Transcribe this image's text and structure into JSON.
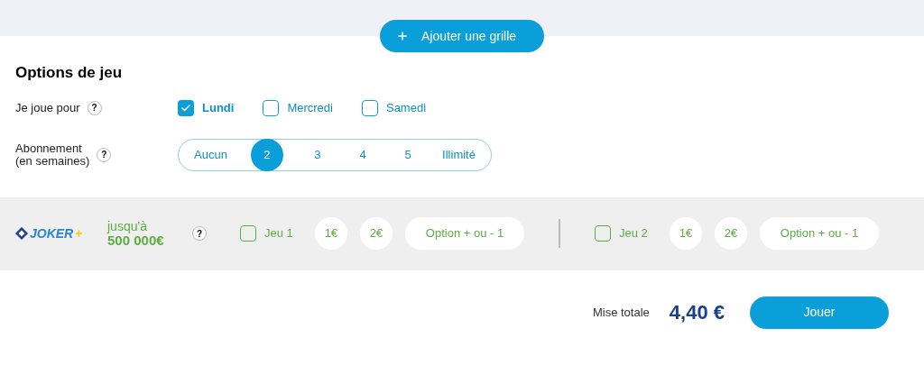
{
  "add_button": {
    "label": "Ajouter une grille"
  },
  "options": {
    "title": "Options de jeu",
    "days": {
      "label": "Je joue pour",
      "help": "?",
      "items": [
        {
          "label": "Lundi",
          "checked": true
        },
        {
          "label": "Mercredi",
          "checked": false
        },
        {
          "label": "Samedi",
          "checked": false
        }
      ]
    },
    "subscription": {
      "label_lines": [
        "Abonnement",
        "(en semaines)"
      ],
      "help": "?",
      "items": [
        {
          "label": "Aucun",
          "selected": false
        },
        {
          "label": "2",
          "selected": true
        },
        {
          "label": "3",
          "selected": false
        },
        {
          "label": "4",
          "selected": false
        },
        {
          "label": "5",
          "selected": false
        },
        {
          "label": "Illimité",
          "selected": false
        }
      ]
    }
  },
  "joker": {
    "logo": {
      "main": "JOKER",
      "plus": "+"
    },
    "prize_lines": [
      "jusqu'à",
      "500 000€"
    ],
    "help": "?",
    "games": [
      {
        "label": "Jeu 1",
        "checked": false,
        "stakes": [
          "1€",
          "2€"
        ],
        "option": "Option + ou - 1"
      },
      {
        "label": "Jeu 2",
        "checked": false,
        "stakes": [
          "1€",
          "2€"
        ],
        "option": "Option + ou - 1"
      }
    ]
  },
  "footer": {
    "total_label": "Mise totale",
    "total": "4,40 €",
    "play_button": "Jouer"
  }
}
